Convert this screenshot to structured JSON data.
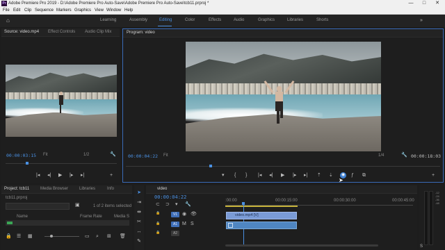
{
  "window": {
    "title": "Adobe Premiere Pro 2019 - D:\\Adobe Premiere Pro Auto-Save\\Adobe Premiere Pro Auto-Save\\tcb11.prproj *",
    "app_icon": "Pr",
    "controls": [
      "—",
      "□",
      "✕"
    ]
  },
  "menu": [
    "File",
    "Edit",
    "Clip",
    "Sequence",
    "Markers",
    "Graphics",
    "View",
    "Window",
    "Help"
  ],
  "workspaces": {
    "tabs": [
      "Learning",
      "Assembly",
      "Editing",
      "Color",
      "Effects",
      "Audio",
      "Graphics",
      "Libraries",
      "Shorts"
    ],
    "active": "Editing"
  },
  "source_panel": {
    "tabs": [
      "Source: video.mp4",
      "Effect Controls",
      "Audio Clip Mix"
    ],
    "timecode": "00:00:03:15",
    "fit": "Fit",
    "resolution": "1/2"
  },
  "program_panel": {
    "tab": "Program: video",
    "timecode": "00:00:04:22",
    "fit": "Fit",
    "resolution": "1/4",
    "duration": "00:00:18:03"
  },
  "project_panel": {
    "tabs": [
      "Project: tcb11",
      "Media Browser",
      "Libraries",
      "Info"
    ],
    "file": "tcb11.prproj",
    "selection": "1 of 2 items selected",
    "columns": [
      "Name",
      "Frame Rate",
      "Media S"
    ]
  },
  "timeline": {
    "tab": "video",
    "timecode": "00:00:04:22",
    "ruler": [
      ":00:00",
      "00:00:15:00",
      "00:00:30:00",
      "00:00:45:00"
    ],
    "tracks": [
      {
        "label": "V1",
        "clip": "video.mp4 [V]"
      },
      {
        "label": "A1",
        "clip": ""
      },
      {
        "label": "A2",
        "clip": ""
      }
    ]
  },
  "tools": [
    "selection-tool",
    "track-select-tool",
    "ripple-edit-tool",
    "razor-tool",
    "slip-tool",
    "pen-tool"
  ],
  "playback_glyphs": {
    "marker": "▾",
    "in": "{",
    "out": "}",
    "go_in": "|◂",
    "step_back": "◂|",
    "play": "▶",
    "step_fwd": "|▸",
    "go_out": "▸|",
    "add": "+",
    "wrench": "🔧"
  },
  "colors": {
    "accent": "#4a90e2",
    "video_clip": "#7a9bd6",
    "audio_clip": "#4f86c2"
  }
}
